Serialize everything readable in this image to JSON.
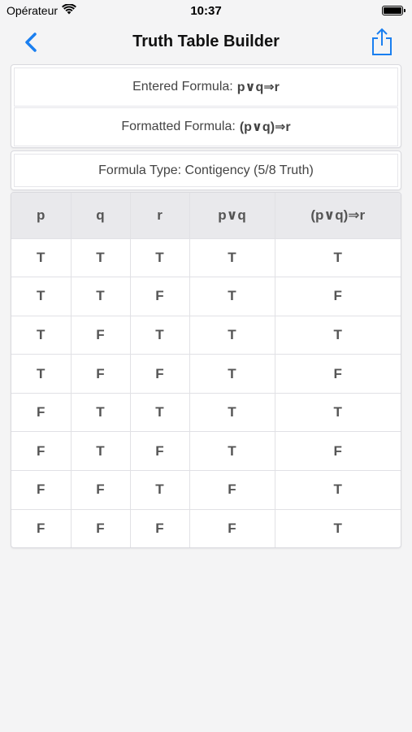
{
  "status_bar": {
    "carrier": "Opérateur",
    "time": "10:37"
  },
  "nav": {
    "title": "Truth Table Builder",
    "back_icon": "chevron-left-icon",
    "share_icon": "share-icon",
    "accent_color": "#1a7ff0"
  },
  "formulas": {
    "entered_label": "Entered Formula:",
    "entered_value": "p∨q⇒r",
    "formatted_label": "Formatted Formula:",
    "formatted_value": "(p∨q)⇒r",
    "type_text": "Formula Type: Contigency (5/8 Truth)"
  },
  "table": {
    "headers": [
      "p",
      "q",
      "r",
      "p∨q",
      "(p∨q)⇒r"
    ],
    "rows": [
      [
        "T",
        "T",
        "T",
        "T",
        "T"
      ],
      [
        "T",
        "T",
        "F",
        "T",
        "F"
      ],
      [
        "T",
        "F",
        "T",
        "T",
        "T"
      ],
      [
        "T",
        "F",
        "F",
        "T",
        "F"
      ],
      [
        "F",
        "T",
        "T",
        "T",
        "T"
      ],
      [
        "F",
        "T",
        "F",
        "T",
        "F"
      ],
      [
        "F",
        "F",
        "T",
        "F",
        "T"
      ],
      [
        "F",
        "F",
        "F",
        "F",
        "T"
      ]
    ]
  }
}
